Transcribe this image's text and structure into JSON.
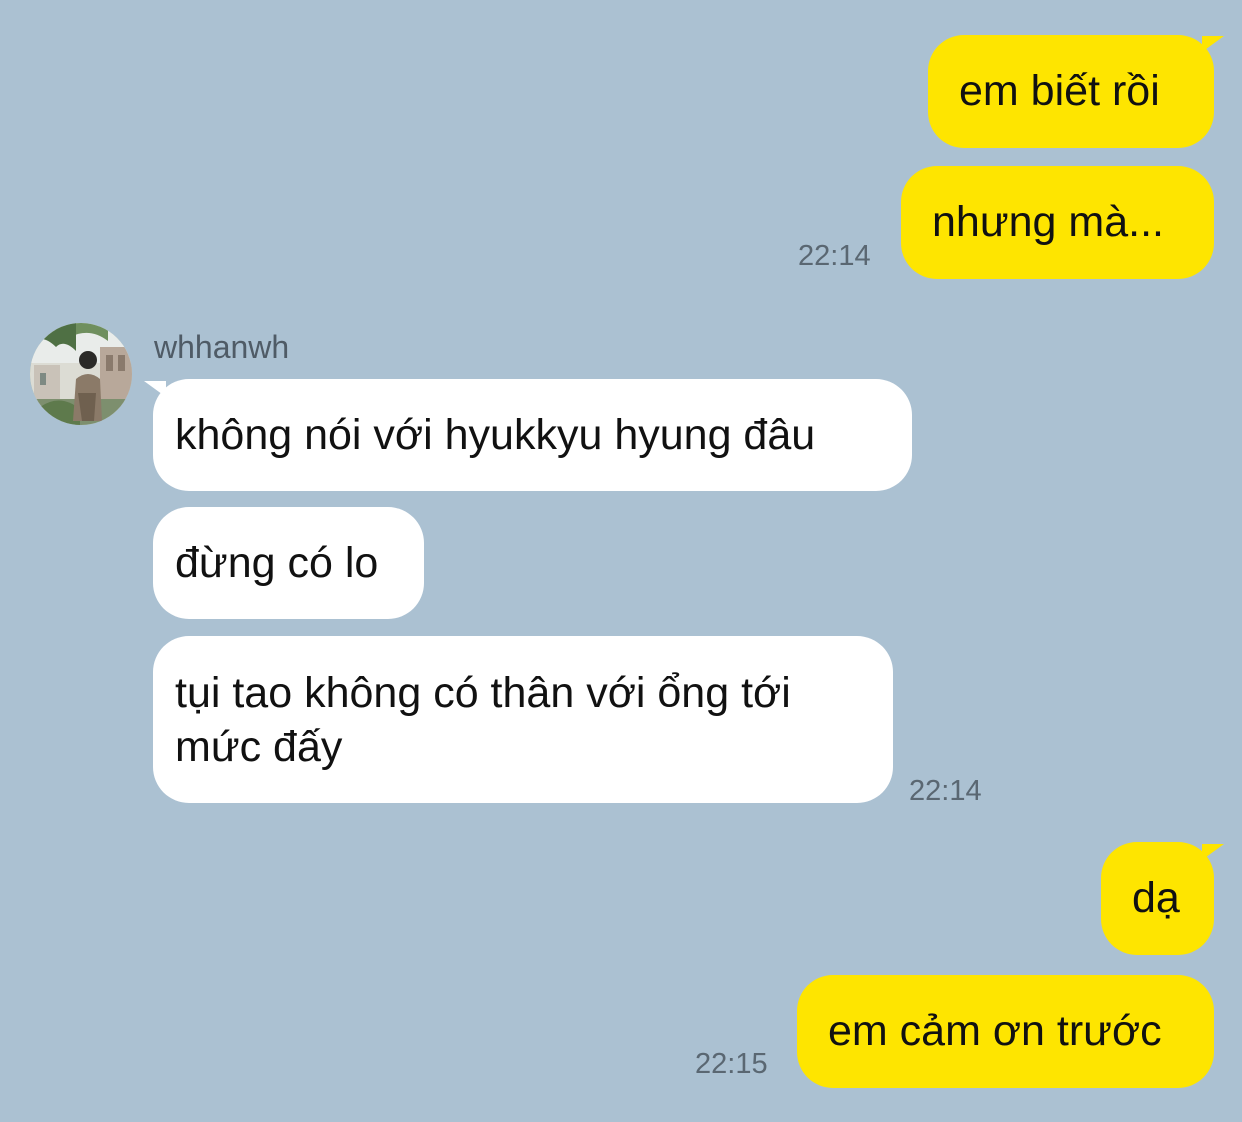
{
  "colors": {
    "background": "#abc1d2",
    "sent_bubble": "#fee500",
    "received_bubble": "#ffffff",
    "timestamp": "#5a6772"
  },
  "contact": {
    "name": "whhanwh",
    "avatar_icon": "profile-photo-icon"
  },
  "messages": [
    {
      "from": "me",
      "text": "em biết rồi"
    },
    {
      "from": "me",
      "text": "nhưng mà...",
      "time": "22:14"
    },
    {
      "from": "whhanwh",
      "text": "không nói với hyukkyu hyung đâu"
    },
    {
      "from": "whhanwh",
      "text": "đừng có lo"
    },
    {
      "from": "whhanwh",
      "text_line1": "tụi tao không có thân với ổng tới",
      "text_line2": "mức đấy",
      "time": "22:14"
    },
    {
      "from": "me",
      "text": "dạ"
    },
    {
      "from": "me",
      "text": "em cảm ơn trước",
      "time": "22:15"
    }
  ]
}
